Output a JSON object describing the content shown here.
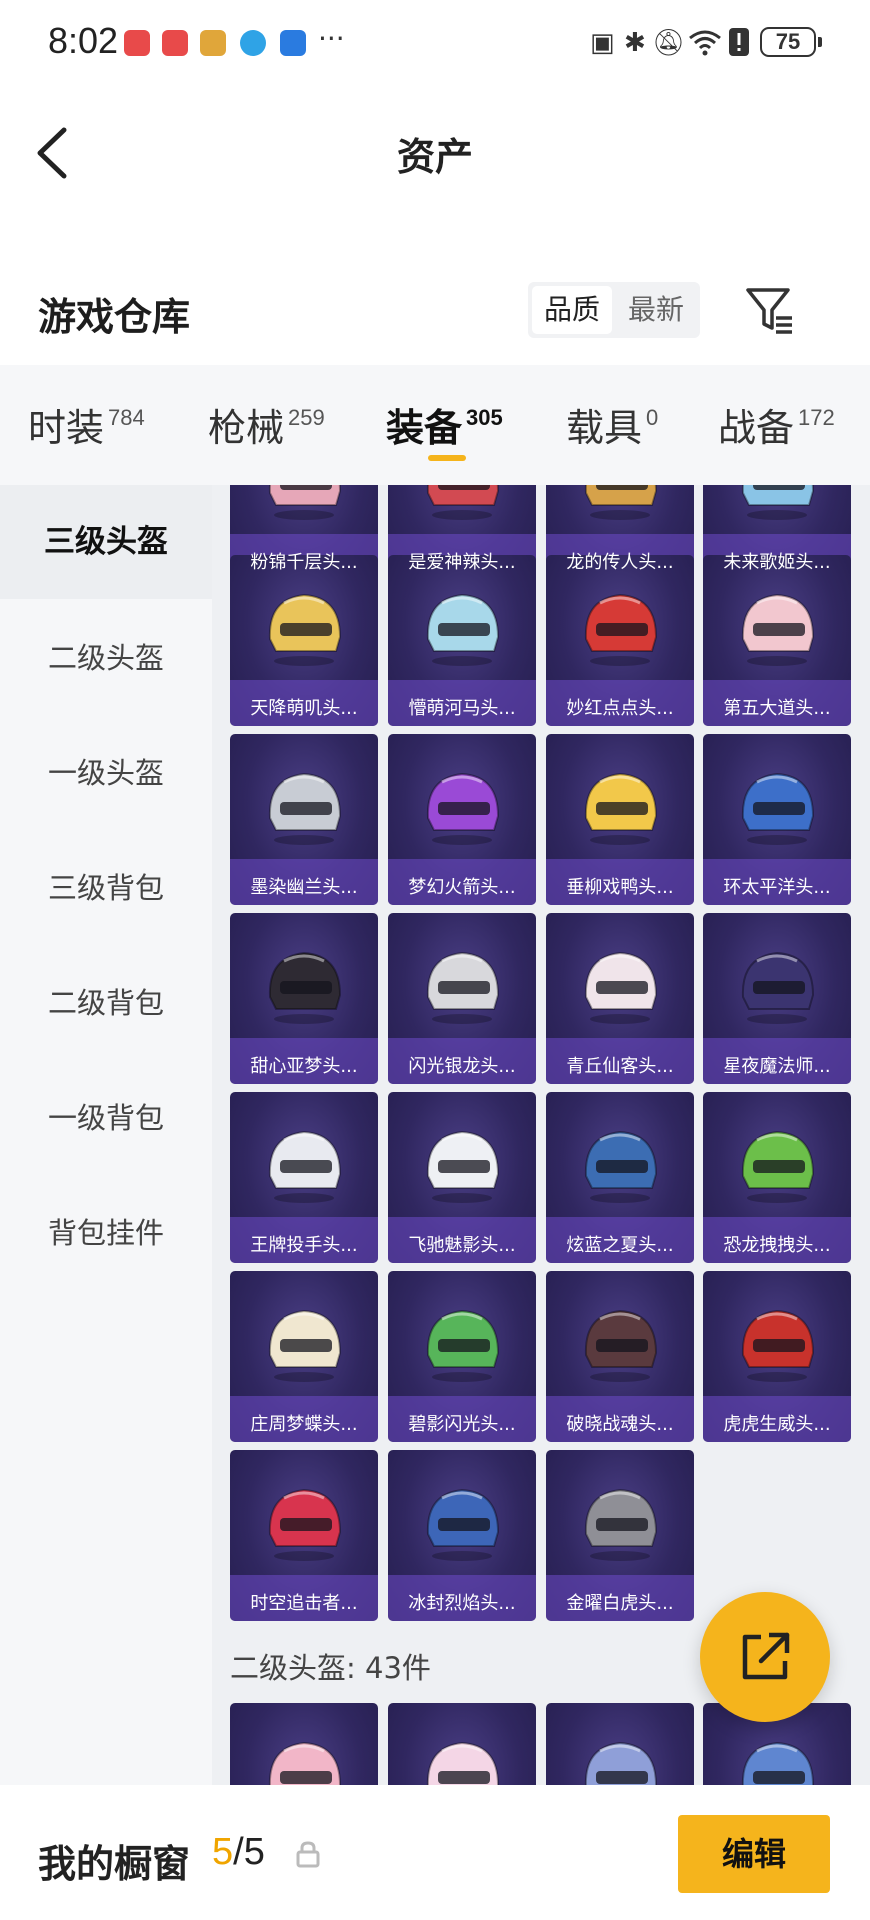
{
  "status_bar": {
    "time": "8:02",
    "more": "···",
    "battery": "75"
  },
  "nav": {
    "title": "资产"
  },
  "header": {
    "section_title": "游戏仓库",
    "sort_options": [
      "品质",
      "最新"
    ],
    "sort_selected": "品质"
  },
  "tabs": [
    {
      "label": "时装",
      "count": "784"
    },
    {
      "label": "枪械",
      "count": "259"
    },
    {
      "label": "装备",
      "count": "305"
    },
    {
      "label": "载具",
      "count": "0"
    },
    {
      "label": "战备",
      "count": "172"
    }
  ],
  "active_tab": "装备",
  "sidebar": {
    "items": [
      "三级头盔",
      "二级头盔",
      "一级头盔",
      "三级背包",
      "二级背包",
      "一级背包",
      "背包挂件"
    ],
    "active": "三级头盔"
  },
  "grid": {
    "items": [
      {
        "name": "粉锦千层头...",
        "color": "#e6a7b8"
      },
      {
        "name": "是爱神辣头...",
        "color": "#d24a52"
      },
      {
        "name": "龙的传人头...",
        "color": "#d6a24a"
      },
      {
        "name": "未来歌姬头...",
        "color": "#8ac4e6"
      },
      {
        "name": "天降萌叽头...",
        "color": "#e9c45a"
      },
      {
        "name": "懵萌河马头...",
        "color": "#a8d8ea"
      },
      {
        "name": "妙红点点头...",
        "color": "#d63a36"
      },
      {
        "name": "第五大道头...",
        "color": "#f2c7cf"
      },
      {
        "name": "墨染幽兰头...",
        "color": "#c8ccd4"
      },
      {
        "name": "梦幻火箭头...",
        "color": "#9a4ad6"
      },
      {
        "name": "垂柳戏鸭头...",
        "color": "#f2c84a"
      },
      {
        "name": "环太平洋头...",
        "color": "#3d6fc9"
      },
      {
        "name": "甜心亚梦头...",
        "color": "#2e2a33"
      },
      {
        "name": "闪光银龙头...",
        "color": "#d8d8dc"
      },
      {
        "name": "青丘仙客头...",
        "color": "#f0e4ea"
      },
      {
        "name": "星夜魔法师...",
        "color": "#3b3470"
      },
      {
        "name": "王牌投手头...",
        "color": "#e8eaf0"
      },
      {
        "name": "飞驰魅影头...",
        "color": "#eef0f4"
      },
      {
        "name": "炫蓝之夏头...",
        "color": "#3c6db3"
      },
      {
        "name": "恐龙拽拽头...",
        "color": "#6cbf4a"
      },
      {
        "name": "庄周梦蝶头...",
        "color": "#f0e7d0"
      },
      {
        "name": "碧影闪光头...",
        "color": "#57b55a"
      },
      {
        "name": "破晓战魂头...",
        "color": "#5a3a3e"
      },
      {
        "name": "虎虎生威头...",
        "color": "#c8322c"
      },
      {
        "name": "时空追击者...",
        "color": "#d8344e"
      },
      {
        "name": "冰封烈焰头...",
        "color": "#3d66b8"
      },
      {
        "name": "金曜白虎头...",
        "color": "#8f8f96"
      }
    ],
    "next_group_label": "二级头盔: 43件",
    "next_group_items": [
      {
        "color": "#f2b6c8"
      },
      {
        "color": "#f4d6e6"
      },
      {
        "color": "#8f9fd8"
      },
      {
        "color": "#5f86d0"
      }
    ]
  },
  "bottom_bar": {
    "window_label": "我的橱窗",
    "window_used": "5",
    "window_total": "/5",
    "edit_label": "编辑"
  },
  "colors": {
    "accent": "#f5b41c",
    "card_bg": "#302760",
    "card_caption_bg": "#6e4bc8"
  }
}
